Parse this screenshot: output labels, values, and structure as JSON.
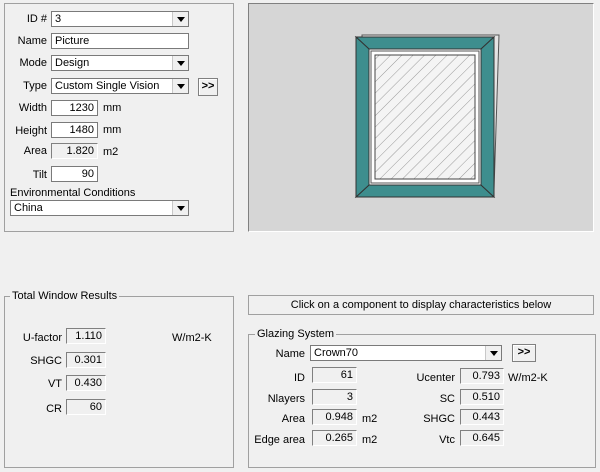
{
  "properties": {
    "id_label": "ID #",
    "id_value": "3",
    "name_label": "Name",
    "name_value": "Picture",
    "mode_label": "Mode",
    "mode_value": "Design",
    "type_label": "Type",
    "type_value": "Custom Single Vision",
    "type_more": ">>",
    "width_label": "Width",
    "width_value": "1230",
    "width_unit": "mm",
    "height_label": "Height",
    "height_value": "1480",
    "height_unit": "mm",
    "area_label": "Area",
    "area_value": "1.820",
    "area_unit": "m2",
    "tilt_label": "Tilt",
    "tilt_value": "90",
    "env_label": "Environmental Conditions",
    "env_value": "China"
  },
  "preview": {
    "frame_color": "#3e8e8e",
    "background": "#d6d6d6"
  },
  "results": {
    "title": "Total Window Results",
    "ufactor_label": "U-factor",
    "ufactor_value": "1.110",
    "ufactor_unit": "W/m2-K",
    "shgc_label": "SHGC",
    "shgc_value": "0.301",
    "vt_label": "VT",
    "vt_value": "0.430",
    "cr_label": "CR",
    "cr_value": "60"
  },
  "hint": "Click on a component to display characteristics below",
  "glazing": {
    "title": "Glazing System",
    "name_label": "Name",
    "name_value": "Crown70",
    "more": ">>",
    "id_label": "ID",
    "id_value": "61",
    "nlayers_label": "Nlayers",
    "nlayers_value": "3",
    "area_label": "Area",
    "area_value": "0.948",
    "area_unit": "m2",
    "edge_label": "Edge area",
    "edge_value": "0.265",
    "edge_unit": "m2",
    "ucenter_label": "Ucenter",
    "ucenter_value": "0.793",
    "ucenter_unit": "W/m2-K",
    "sc_label": "SC",
    "sc_value": "0.510",
    "shgc_label": "SHGC",
    "shgc_value": "0.443",
    "vtc_label": "Vtc",
    "vtc_value": "0.645"
  }
}
